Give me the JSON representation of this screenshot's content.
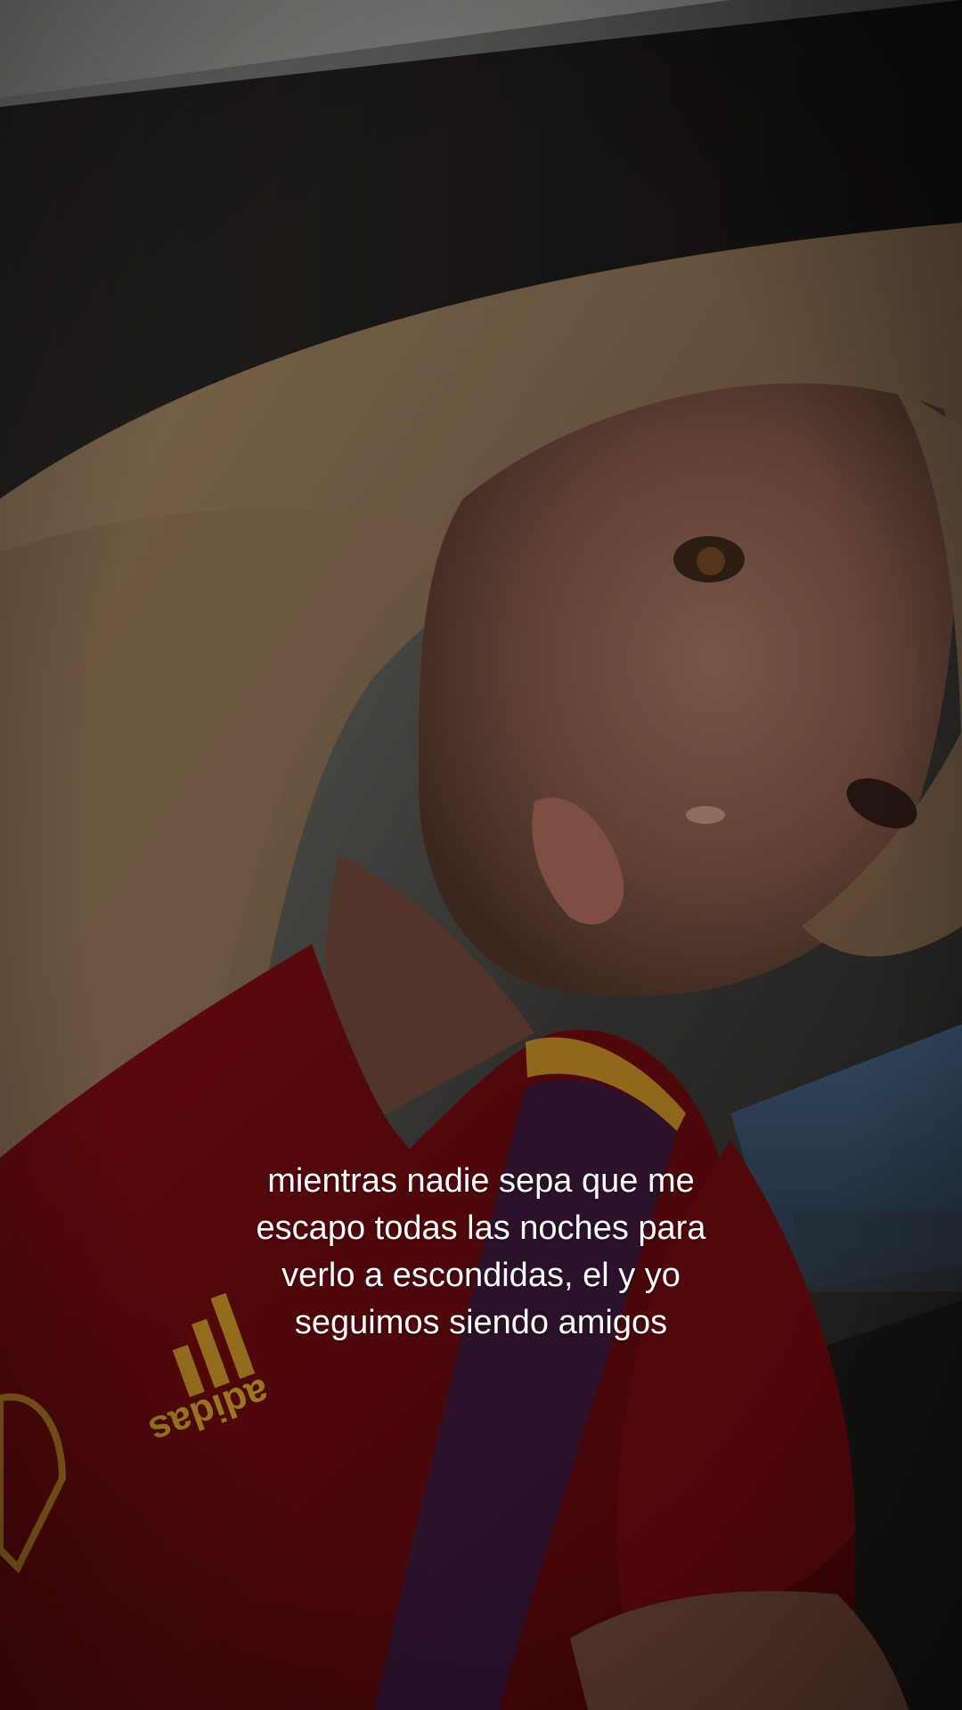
{
  "video": {
    "caption": {
      "lines": [
        "mientras nadie sepa que me",
        "escapo todas las noches para",
        "verlo a escondidas, el y yo",
        "seguimos siendo amigos"
      ]
    },
    "jersey_text": "adidas"
  }
}
